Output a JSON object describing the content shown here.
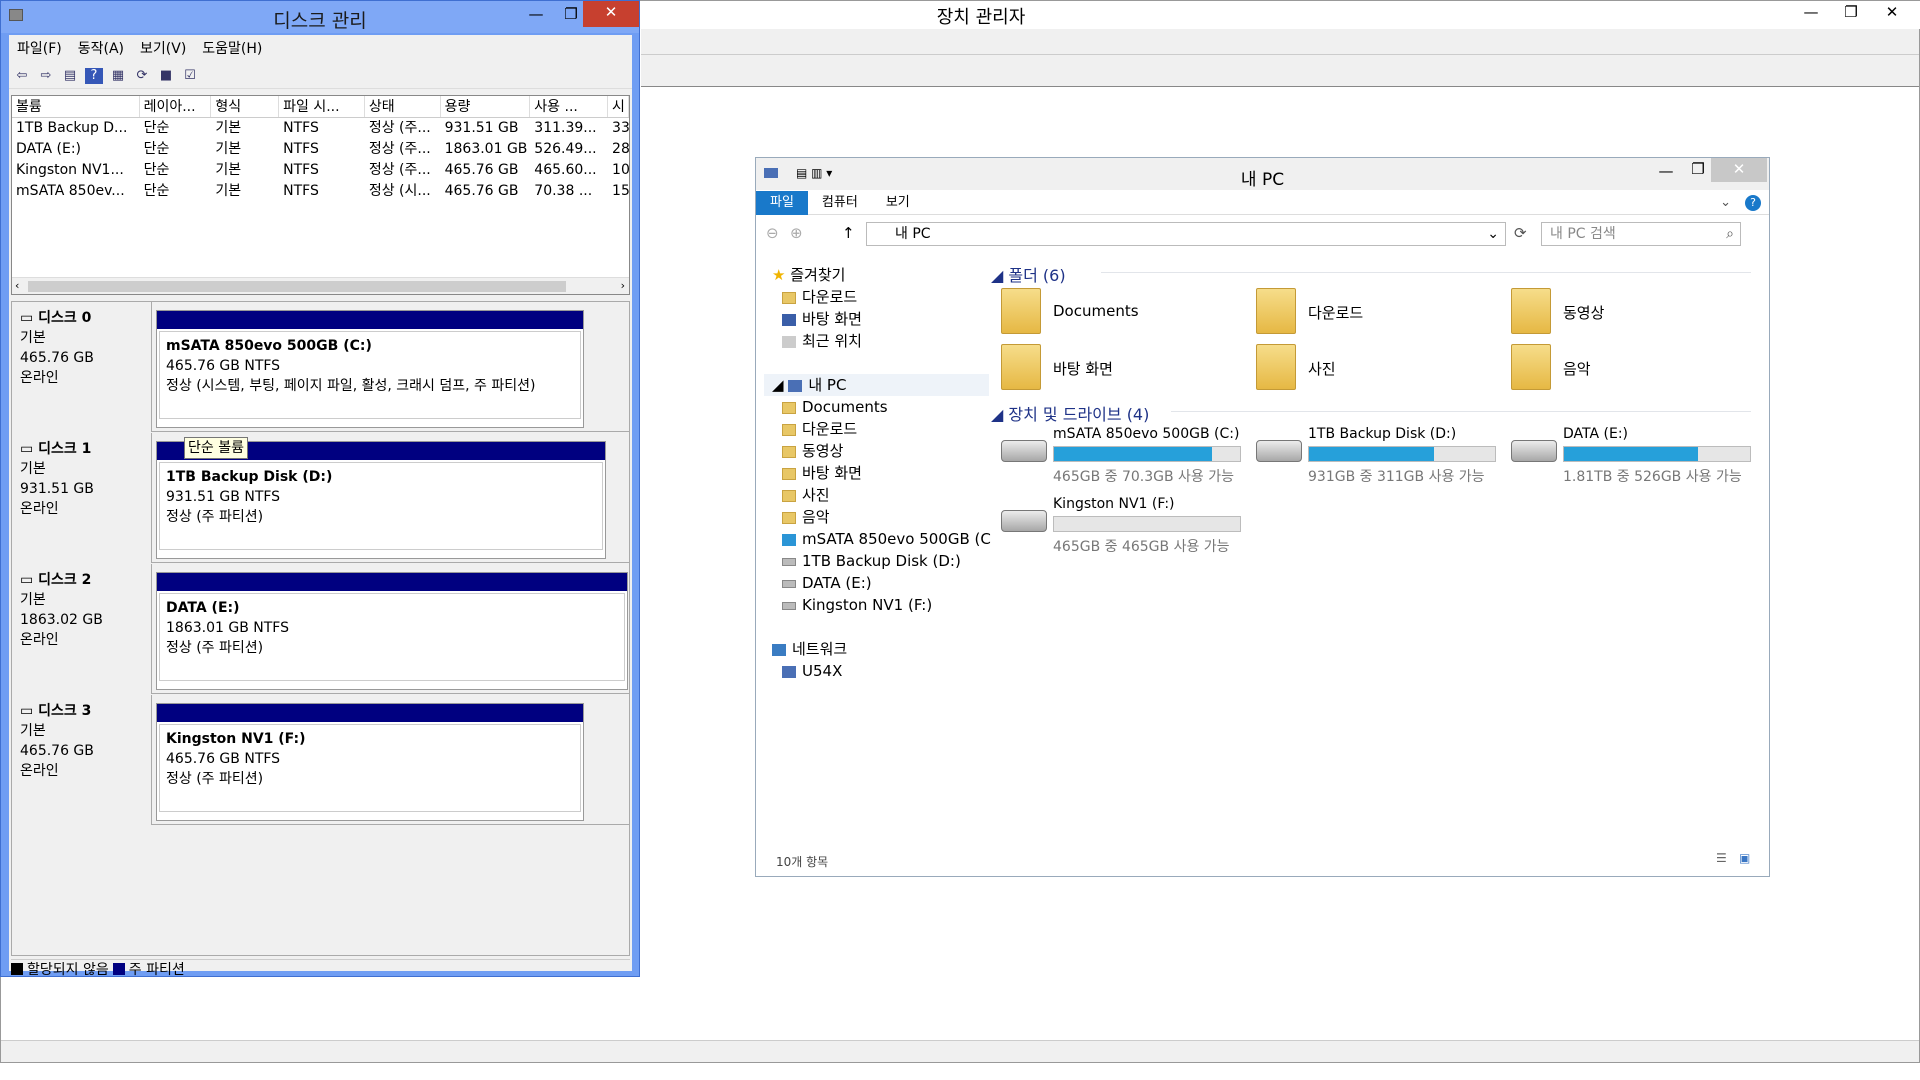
{
  "device_manager": {
    "title": "장치 관리자",
    "controls": {
      "min": "—",
      "max": "❐",
      "close": "✕"
    }
  },
  "disk_mgmt": {
    "title": "디스크 관리",
    "menu": [
      "파일(F)",
      "동작(A)",
      "보기(V)",
      "도움말(H)"
    ],
    "columns": [
      "볼륨",
      "레이아...",
      "형식",
      "파일 시...",
      "상태",
      "용량",
      "사용 ...",
      "시"
    ],
    "volumes": [
      {
        "name": "1TB Backup D...",
        "layout": "단순",
        "type": "기본",
        "fs": "NTFS",
        "status": "정상 (주...",
        "capacity": "931.51 GB",
        "free": "311.39...",
        "pct": "33"
      },
      {
        "name": "DATA (E:)",
        "layout": "단순",
        "type": "기본",
        "fs": "NTFS",
        "status": "정상 (주...",
        "capacity": "1863.01 GB",
        "free": "526.49...",
        "pct": "28"
      },
      {
        "name": "Kingston NV1...",
        "layout": "단순",
        "type": "기본",
        "fs": "NTFS",
        "status": "정상 (주...",
        "capacity": "465.76 GB",
        "free": "465.60...",
        "pct": "10"
      },
      {
        "name": "mSATA 850ev...",
        "layout": "단순",
        "type": "기본",
        "fs": "NTFS",
        "status": "정상 (시...",
        "capacity": "465.76 GB",
        "free": "70.38 ...",
        "pct": "15"
      }
    ],
    "disks": [
      {
        "label": "디스크 0",
        "kind": "기본",
        "size": "465.76 GB",
        "state": "온라인",
        "part_title": "mSATA 850evo 500GB  (C:)",
        "part_size": "465.76 GB NTFS",
        "part_status": "정상 (시스템, 부팅, 페이지 파일, 활성, 크래시 덤프, 주 파티션)"
      },
      {
        "label": "디스크 1",
        "kind": "기본",
        "size": "931.51 GB",
        "state": "온라인",
        "part_title": "1TB Backup Disk  (D:)",
        "part_size": "931.51 GB NTFS",
        "part_status": "정상 (주 파티션)"
      },
      {
        "label": "디스크 2",
        "kind": "기본",
        "size": "1863.02 GB",
        "state": "온라인",
        "part_title": "DATA  (E:)",
        "part_size": "1863.01 GB NTFS",
        "part_status": "정상 (주 파티션)"
      },
      {
        "label": "디스크 3",
        "kind": "기본",
        "size": "465.76 GB",
        "state": "온라인",
        "part_title": "Kingston NV1  (F:)",
        "part_size": "465.76 GB NTFS",
        "part_status": "정상 (주 파티션)"
      }
    ],
    "tooltip": "단순 볼륨",
    "legend": {
      "unallocated": "할당되지 않음",
      "primary": "주 파티션"
    }
  },
  "explorer": {
    "title": "내 PC",
    "ribbon": [
      "파일",
      "컴퓨터",
      "보기"
    ],
    "address": "내 PC",
    "search_placeholder": "내 PC 검색",
    "nav": {
      "favorites": "즐겨찾기",
      "fav_items": [
        "다운로드",
        "바탕 화면",
        "최근 위치"
      ],
      "this_pc": "내 PC",
      "pc_items": [
        "Documents",
        "다운로드",
        "동영상",
        "바탕 화면",
        "사진",
        "음악"
      ],
      "drives": [
        "mSATA 850evo 500GB (C",
        "1TB Backup Disk (D:)",
        "DATA (E:)",
        "Kingston NV1 (F:)"
      ],
      "network": "네트워크",
      "net_items": [
        "U54X"
      ]
    },
    "folders_header": "폴더 (6)",
    "folders": [
      "Documents",
      "다운로드",
      "동영상",
      "바탕 화면",
      "사진",
      "음악"
    ],
    "drives_header": "장치 및 드라이브 (4)",
    "drives": [
      {
        "name": "mSATA 850evo 500GB (C:)",
        "info": "465GB 중 70.3GB 사용 가능",
        "used": 0.85
      },
      {
        "name": "1TB Backup Disk (D:)",
        "info": "931GB 중 311GB 사용 가능",
        "used": 0.67
      },
      {
        "name": "DATA (E:)",
        "info": "1.81TB 중 526GB 사용 가능",
        "used": 0.72
      },
      {
        "name": "Kingston NV1 (F:)",
        "info": "465GB 중 465GB 사용 가능",
        "used": 0.0
      }
    ],
    "status": "10개 항목"
  },
  "colors": {
    "accent": "#26a0da",
    "partition": "#000080",
    "ribbon_file": "#1979ca",
    "dm_frame": "#6f9df3"
  }
}
